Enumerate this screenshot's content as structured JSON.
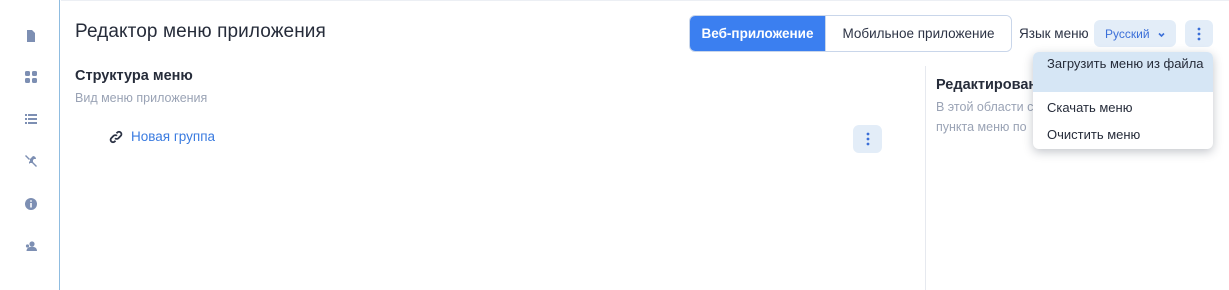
{
  "sidebar": {
    "items": [
      {
        "icon": "document-icon"
      },
      {
        "icon": "grid-icon"
      },
      {
        "icon": "list-icon"
      },
      {
        "icon": "tools-icon"
      },
      {
        "icon": "info-icon"
      },
      {
        "icon": "users-icon"
      }
    ]
  },
  "header": {
    "title": "Редактор меню приложения",
    "tabs": [
      {
        "label": "Веб-приложение",
        "active": true
      },
      {
        "label": "Мобильное приложение",
        "active": false
      }
    ],
    "language_label": "Язык меню",
    "language_value": "Русский"
  },
  "structure": {
    "title": "Структура меню",
    "subtitle": "Вид меню приложения",
    "items": [
      {
        "label": "Новая группа",
        "icon": "link-icon"
      }
    ]
  },
  "editor": {
    "title": "Редактирован",
    "subtitle_line1": "В этой области с",
    "subtitle_line2": "пункта меню по"
  },
  "dropdown_menu": {
    "items": [
      {
        "label": "Загрузить меню из файла",
        "highlighted": true
      },
      {
        "label": "Скачать меню",
        "highlighted": false
      },
      {
        "label": "Очистить меню",
        "highlighted": false
      }
    ]
  },
  "colors": {
    "accent": "#3b7ff0",
    "link": "#3a7be0",
    "chip_bg": "#e3edf8",
    "highlight": "#d6e6f5"
  }
}
